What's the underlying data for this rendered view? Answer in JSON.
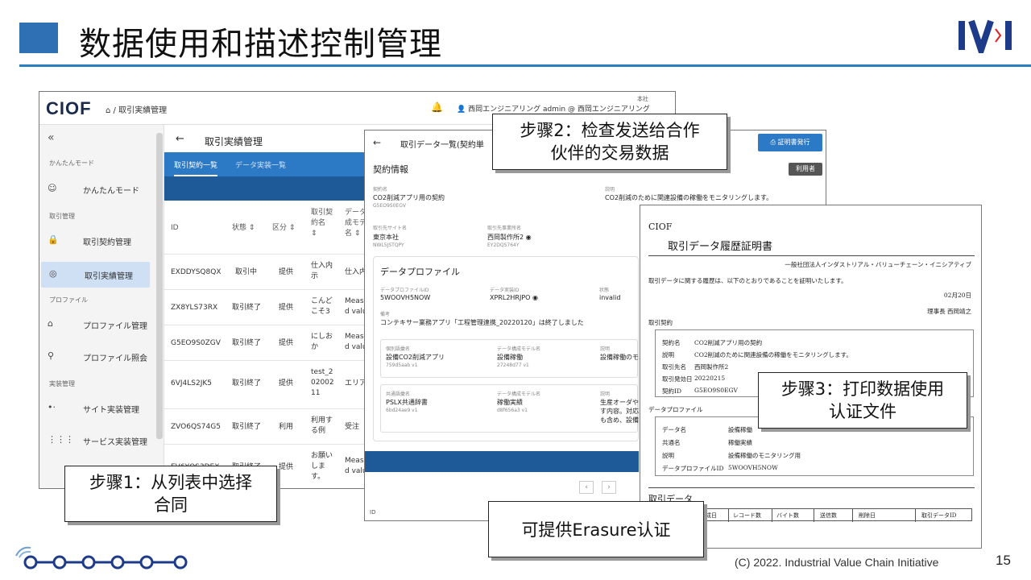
{
  "slide": {
    "title": "数据使用和描述控制管理",
    "logo": "IVI",
    "footer": "(C) 2022. Industrial Value Chain Initiative",
    "page_number": "15"
  },
  "colors": {
    "accent": "#2f6fb3",
    "rule": "#2a7fc1",
    "tabbar": "#2c79c6",
    "band": "#1e5a97"
  },
  "callouts": {
    "step1": "步骤1：从列表中选择\n合同",
    "step2": "步骤2：检查发送给合作\n伙伴的交易数据",
    "step3": "步骤3：打印数据使用\n认证文件",
    "erasure": "可提供Erasure认证"
  },
  "screen1": {
    "logo": "CIOF",
    "breadcrumb": "⌂ / 取引実績管理",
    "user": "西岡エンジニアリング admin @ 西岡エンジニアリング",
    "honsha": "本社",
    "collapse": "«",
    "sidebar": [
      {
        "section": "かんたんモード"
      },
      {
        "icon": "☺",
        "label": "かんたんモード"
      },
      {
        "section": "取引管理"
      },
      {
        "icon": "🔒",
        "label": "取引契約管理"
      },
      {
        "icon": "◎",
        "label": "取引実績管理",
        "active": true
      },
      {
        "section": "プロファイル"
      },
      {
        "icon": "⌂",
        "label": "プロファイル管理"
      },
      {
        "icon": "⚲",
        "label": "プロファイル照会"
      },
      {
        "section": "実装管理"
      },
      {
        "icon": "•·",
        "label": "サイト実装管理"
      },
      {
        "icon": "⋮⋮⋮",
        "label": "サービス実装管理"
      }
    ],
    "page_title": "取引実績管理",
    "tabs": [
      "取引契約一覧",
      "データ実装一覧"
    ],
    "columns": [
      "ID",
      "状態 ⇕",
      "区分 ⇕",
      "取引契\n約名\n⇕",
      "データ\n成モデ\n名 ⇕"
    ],
    "rows": [
      {
        "id": "EXDDYSQ8QX",
        "status": "取引中",
        "type": "提供",
        "name": "仕入内\n示",
        "model": "仕入内"
      },
      {
        "id": "ZX8YLS73RX",
        "status": "取引終了",
        "type": "提供",
        "name": "こんど\nこそ3",
        "model": "Measu\nd value"
      },
      {
        "id": "G5EO9S0ZGV",
        "status": "取引終了",
        "type": "提供",
        "name": "にしお\nか",
        "model": "Measu\nd value"
      },
      {
        "id": "6VJ4LS2JK5",
        "status": "取引終了",
        "type": "提供",
        "name": "test_2\n02002\n11",
        "model": "エリア"
      },
      {
        "id": "ZVO6QS74G5",
        "status": "取引終了",
        "type": "利用",
        "name": "利用す\nる例",
        "model": "受注"
      },
      {
        "id": "EV6YQS3DEX",
        "status": "取引終了",
        "type": "提供",
        "name": "お願い\nしま\nす。",
        "model": "Measu\nd value"
      }
    ]
  },
  "screen2": {
    "title": "取引データ一覧(契約単",
    "cert_button": "証明書発行",
    "user_badge": "利用者",
    "section": "契約情報",
    "contract_label": "契約名",
    "contract_name": "CO2削減アプリ用の契約",
    "contract_id": "G5EO9S0EGV",
    "desc_label": "説明",
    "desc": "CO2削減のために関連設備の稼働をモニタリングします。",
    "site_label": "取引先サイト名",
    "site": "東京本社",
    "site_id": "NWL5JSTQPY",
    "office_label": "取引先事業所名",
    "office": "西岡製作所2",
    "office_id": "EY2DQS764Y",
    "profile_h": "データプロファイル",
    "profile_id_label": "データプロファイルID",
    "profile_id": "5WOOVH5NOW",
    "impl_label": "データ実装ID",
    "impl_id": "XPRL2HRJPO",
    "state_label": "状態",
    "state": "invalid",
    "note_label": "備考",
    "note": "コンテキサー業務アプリ「工程管理連携_20220120」は終了しました",
    "i1_k1": "個別語彙名",
    "i1_v1": "設備CO2削減アプリ",
    "i1_s1": "759d5aab v1",
    "i1_k2": "データ構成モデル名",
    "i1_v2": "設備稼働",
    "i1_s2": "27248d77 v1",
    "i1_k3": "説明",
    "i1_v3": "設備稼働のモニ",
    "i2_k1": "共通語彙名",
    "i2_v1": "PSLX共通辞書",
    "i2_s1": "6bd24ae9 v1",
    "i2_k2": "データ構成モデル名",
    "i2_v2": "稼働実績",
    "i2_s2": "d8f656a3 v1",
    "i2_k3": "説明",
    "i2_v3": "生産オーダや\nす内容。対応\nも含め、設備",
    "id_label": "ID"
  },
  "certificate": {
    "logo": "CIOF",
    "title": "取引データ履歴証明書",
    "issuer": "一般社団法人インダストリアル・バリューチェーン・イニシアティブ",
    "statement": "取引データに関する履歴は、以下のとおりであることを証明いたします。",
    "date": "02月20日",
    "signer": "理事長 西岡靖之",
    "sec_contract": "取引契約",
    "contract_rows": [
      {
        "k": "契約名",
        "v": "CO2削減アプリ用の契約"
      },
      {
        "k": "説明",
        "v": "CO2削減のために関連設備の稼働をモニタリングします。"
      },
      {
        "k": "取引先名",
        "v": "西岡製作所2"
      },
      {
        "k": "取引発効日",
        "v": "20220215"
      },
      {
        "k": "契約ID",
        "v": "G5EO9S0EGV"
      }
    ],
    "sec_profile": "データプロファイル",
    "profile_rows": [
      {
        "k": "データ名",
        "v": "設備稼働"
      },
      {
        "k": "共通名",
        "v": "稼働実績"
      },
      {
        "k": "説明",
        "v": "設備稼働のモニタリング用"
      },
      {
        "k": "データプロファイルID",
        "v": "5WOOVH5NOW"
      }
    ],
    "sec_data": "取引データ",
    "data_columns": [
      "成日",
      "レコード数",
      "バイト数",
      "送信数",
      "削除日",
      "取引データID"
    ]
  }
}
